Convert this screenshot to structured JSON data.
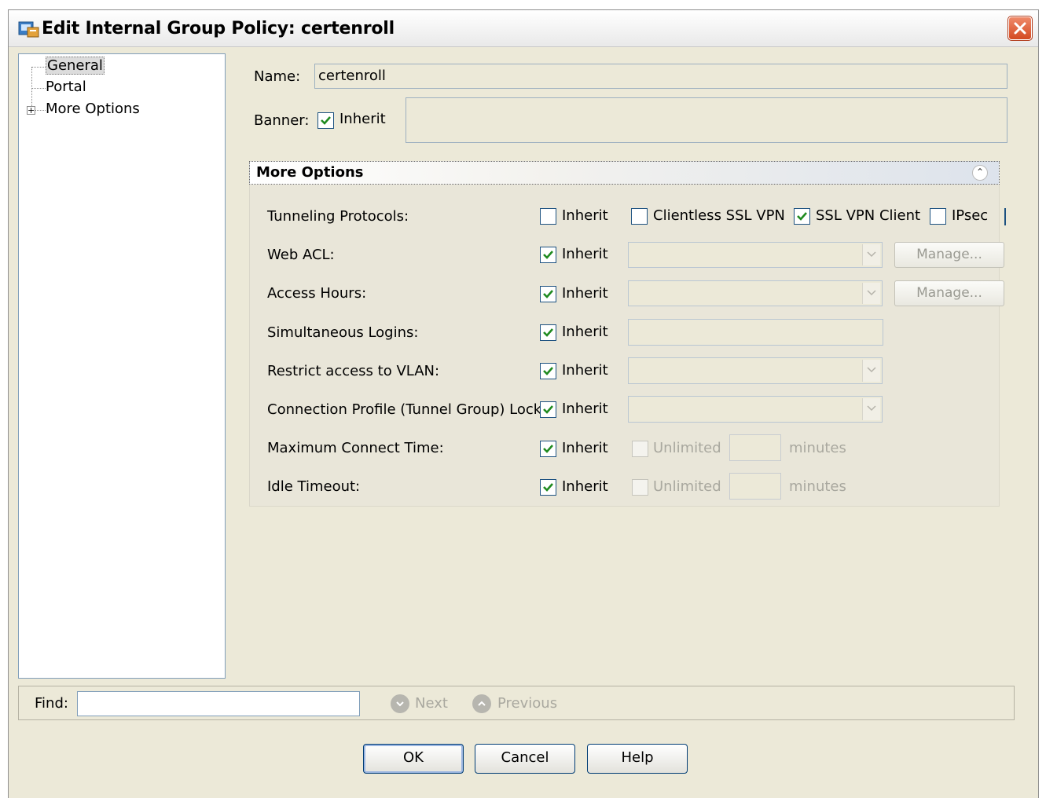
{
  "window": {
    "title": "Edit Internal Group Policy: certenroll"
  },
  "tree": {
    "items": [
      {
        "label": "General",
        "selected": true
      },
      {
        "label": "Portal",
        "selected": false
      },
      {
        "label": "More Options",
        "selected": false,
        "expandable": true
      }
    ]
  },
  "form": {
    "name_label": "Name:",
    "name_value": "certenroll",
    "banner_label": "Banner:",
    "banner_inherit_label": "Inherit",
    "banner_inherit_checked": true
  },
  "more_options": {
    "title": "More Options",
    "inherit_label": "Inherit",
    "tunneling": {
      "label": "Tunneling Protocols:",
      "inherit_checked": false,
      "clientless_label": "Clientless SSL VPN",
      "clientless_checked": false,
      "sslvpn_label": "SSL VPN Client",
      "sslvpn_checked": true,
      "ipsec_label": "IPsec",
      "ipsec_checked": false
    },
    "web_acl": {
      "label": "Web ACL:",
      "manage_label": "Manage..."
    },
    "access_hours": {
      "label": "Access Hours:",
      "manage_label": "Manage..."
    },
    "simultaneous_logins": {
      "label": "Simultaneous Logins:"
    },
    "restrict_vlan": {
      "label": "Restrict access to VLAN:"
    },
    "tunnel_group_lock": {
      "label": "Connection Profile (Tunnel Group) Lock:"
    },
    "max_connect_time": {
      "label": "Maximum Connect Time:",
      "unlimited_label": "Unlimited",
      "minutes_label": "minutes"
    },
    "idle_timeout": {
      "label": "Idle Timeout:",
      "unlimited_label": "Unlimited",
      "minutes_label": "minutes"
    }
  },
  "find": {
    "label": "Find:",
    "next_label": "Next",
    "previous_label": "Previous"
  },
  "buttons": {
    "ok": "OK",
    "cancel": "Cancel",
    "help": "Help"
  },
  "colors": {
    "check": "#1f8a1f",
    "close": "#d34a22",
    "accent": "#003c74"
  }
}
